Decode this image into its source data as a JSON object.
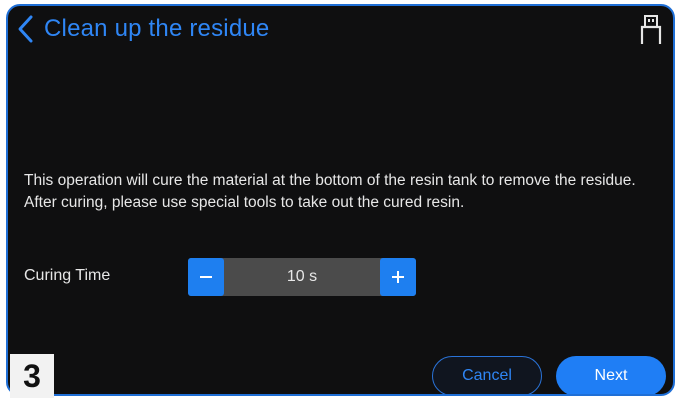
{
  "header": {
    "title": "Clean up the residue",
    "back_icon": "chevron-left-icon",
    "status_icon": "usb-drive-icon"
  },
  "content": {
    "description": "This operation will cure the material at the bottom of the resin tank to remove the residue. After curing, please use special tools to take out the cured resin.",
    "curing_time": {
      "label": "Curing Time",
      "value": "10 s",
      "decrement_icon": "minus-icon",
      "increment_icon": "plus-icon"
    }
  },
  "actions": {
    "cancel_label": "Cancel",
    "next_label": "Next"
  },
  "step_badge": "3",
  "colors": {
    "accent": "#1f7ef5",
    "background": "#0f0f10",
    "text": "#e7e7e7"
  }
}
